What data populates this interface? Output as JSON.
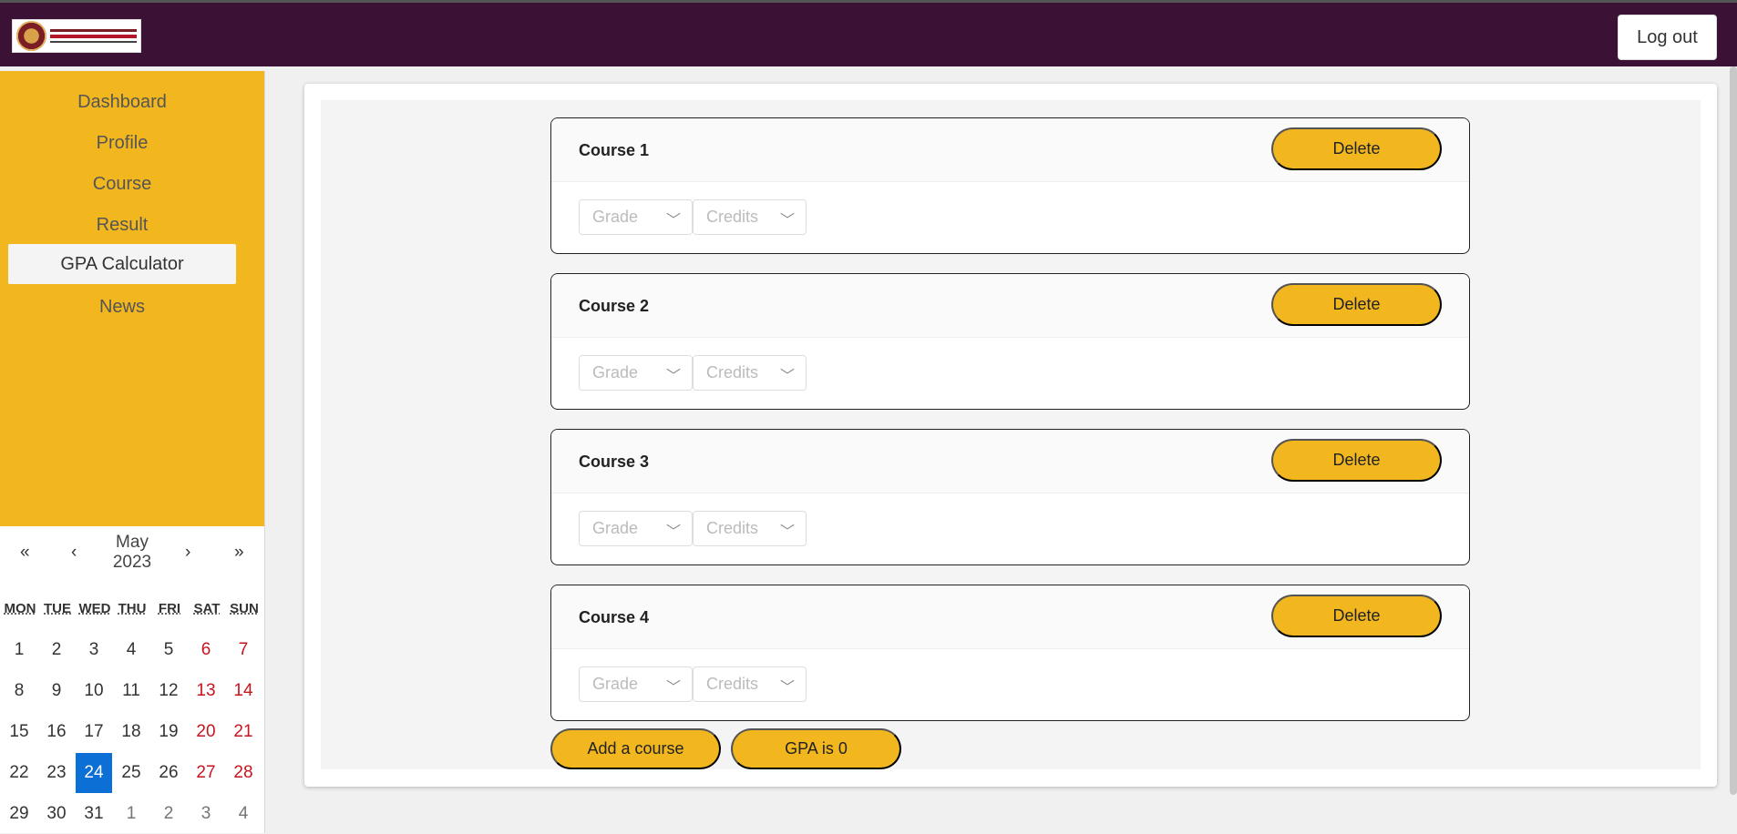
{
  "header": {
    "logout_label": "Log out"
  },
  "sidebar": {
    "items": [
      {
        "label": "Dashboard",
        "active": false
      },
      {
        "label": "Profile",
        "active": false
      },
      {
        "label": "Course",
        "active": false
      },
      {
        "label": "Result",
        "active": false
      },
      {
        "label": "GPA Calculator",
        "active": true
      },
      {
        "label": "News",
        "active": false
      }
    ]
  },
  "calendar": {
    "prev_year": "«",
    "prev_month": "‹",
    "next_month": "›",
    "next_year": "»",
    "month": "May",
    "year": "2023",
    "weekdays": [
      "MON",
      "TUE",
      "WED",
      "THU",
      "FRI",
      "SAT",
      "SUN"
    ],
    "weeks": [
      [
        "1",
        "2",
        "3",
        "4",
        "5",
        "6",
        "7"
      ],
      [
        "8",
        "9",
        "10",
        "11",
        "12",
        "13",
        "14"
      ],
      [
        "15",
        "16",
        "17",
        "18",
        "19",
        "20",
        "21"
      ],
      [
        "22",
        "23",
        "24",
        "25",
        "26",
        "27",
        "28"
      ],
      [
        "29",
        "30",
        "31",
        "1",
        "2",
        "3",
        "4"
      ]
    ],
    "selected_day": "24",
    "colors": {
      "weekend": "#c8141e",
      "selected": "#0b6fd6"
    }
  },
  "courses": [
    {
      "title": "Course 1",
      "delete_label": "Delete",
      "grade_placeholder": "Grade",
      "credits_placeholder": "Credits"
    },
    {
      "title": "Course 2",
      "delete_label": "Delete",
      "grade_placeholder": "Grade",
      "credits_placeholder": "Credits"
    },
    {
      "title": "Course 3",
      "delete_label": "Delete",
      "grade_placeholder": "Grade",
      "credits_placeholder": "Credits"
    },
    {
      "title": "Course 4",
      "delete_label": "Delete",
      "grade_placeholder": "Grade",
      "credits_placeholder": "Credits"
    }
  ],
  "actions": {
    "add_course_label": "Add a course",
    "gpa_label": "GPA is 0"
  },
  "theme": {
    "header_bg": "#3b1235",
    "accent": "#f2b71f"
  }
}
